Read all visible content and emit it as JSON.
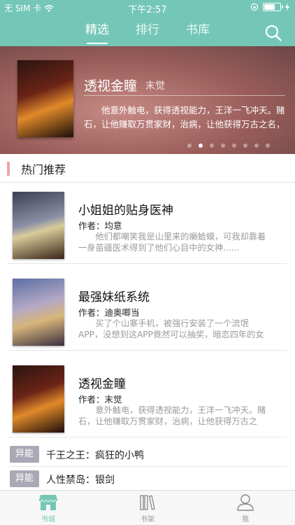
{
  "status_bar": {
    "carrier": "无 SIM 卡",
    "time": "下午2:57"
  },
  "tabs": [
    {
      "label": "精选",
      "active": true
    },
    {
      "label": "排行",
      "active": false
    },
    {
      "label": "书库",
      "active": false
    }
  ],
  "banner": {
    "title": "透视金瞳",
    "author": "末觉",
    "description": "他意外触电，获得透视能力，王洋一飞冲天。赌石，让他赚取万贯家财，治病，让他获得万古之名，",
    "dot_count": 8,
    "active_dot": 1
  },
  "section": {
    "title": "热门推荐"
  },
  "books": [
    {
      "title": "小姐姐的贴身医神",
      "author_label": "作者：",
      "author": "均意",
      "description": "他们都嘲笑我是山里来的癞蛤蟆，可我却靠着一身苗疆医术得到了他们心目中的女神......"
    },
    {
      "title": "最强妹纸系统",
      "author_label": "作者：",
      "author": "迪奥唧当",
      "description": "买了个山寨手机，被强行安装了一个流氓APP，没想到这APP竟然可以抽奖，暗恋四年的女神突然"
    },
    {
      "title": "透视金瞳",
      "author_label": "作者：",
      "author": "末觉",
      "description": "意外触电，获得透视能力，王洋一飞冲天。赌石，让他赚取万贯家财，治病，让他获得万古之"
    }
  ],
  "tag_rows": [
    {
      "tag": "异能",
      "text": "千王之王：疯狂的小鸭"
    },
    {
      "tag": "异能",
      "text": "人性禁岛：银剑"
    }
  ],
  "bottom_nav": [
    {
      "label": "书城",
      "icon": "store-icon",
      "active": true
    },
    {
      "label": "书架",
      "icon": "bookshelf-icon",
      "active": false
    },
    {
      "label": "我",
      "icon": "user-icon",
      "active": false
    }
  ],
  "colors": {
    "accent": "#74c7b6",
    "section_marker": "#f0a49f",
    "tag_bg": "#a8a8b6"
  }
}
